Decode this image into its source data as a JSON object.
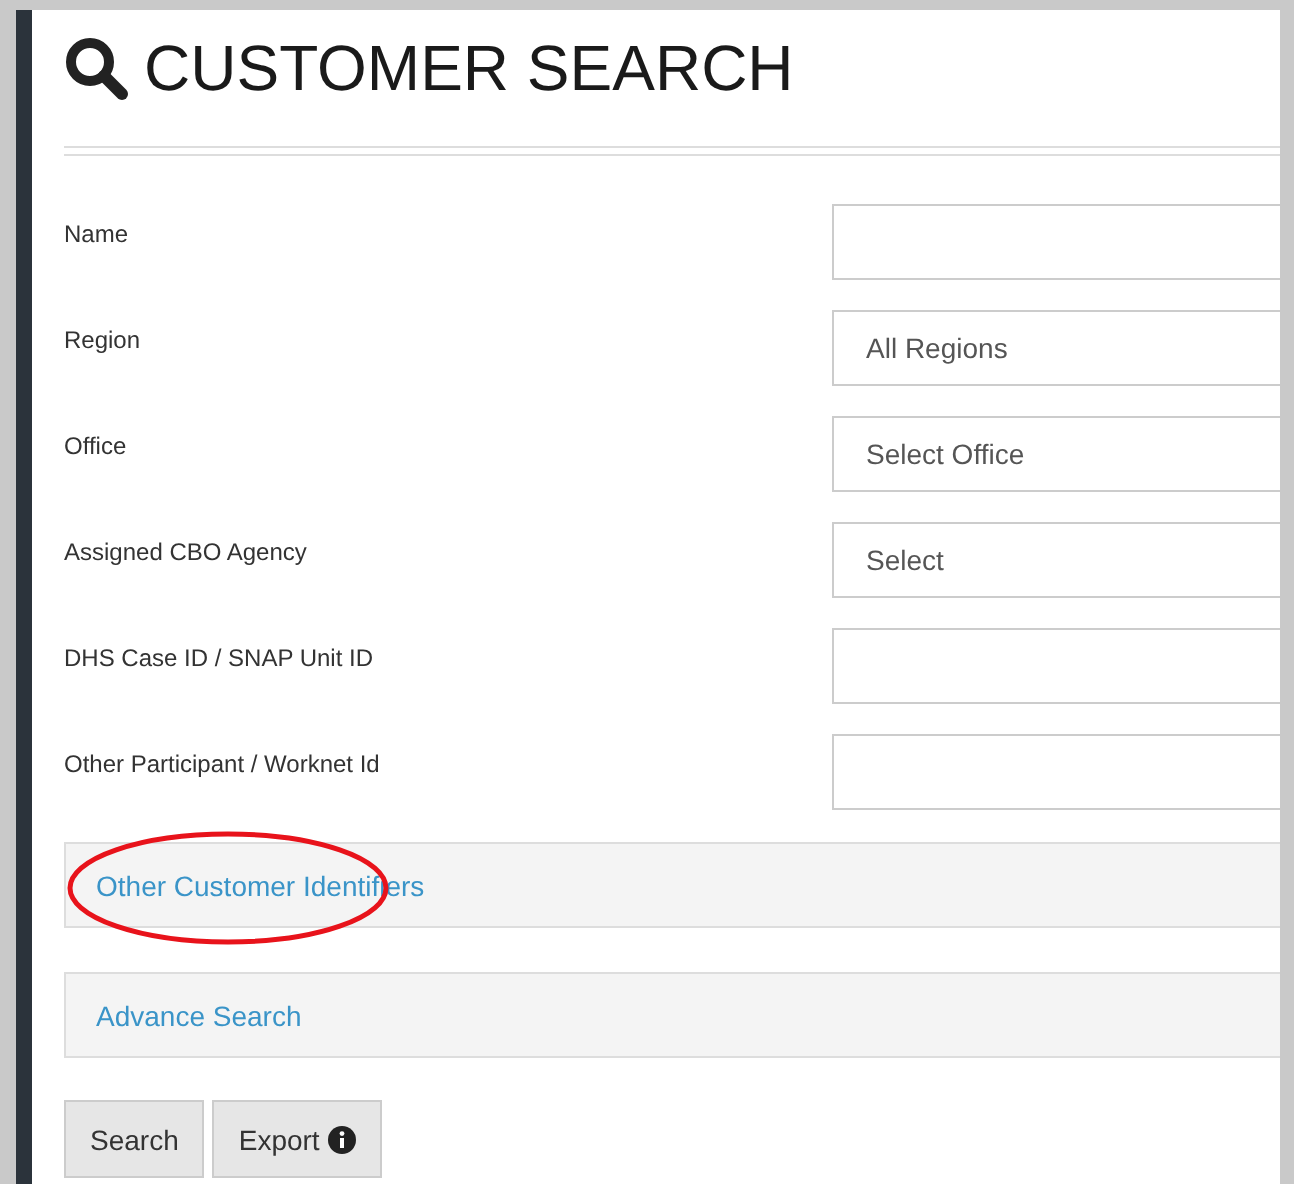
{
  "header": {
    "title": "CUSTOMER SEARCH"
  },
  "fields": [
    {
      "label": "Name"
    },
    {
      "label": "Region",
      "value": "All Regions"
    },
    {
      "label": "Office",
      "value": "Select Office"
    },
    {
      "label": "Assigned CBO Agency",
      "value": "Select"
    },
    {
      "label": "DHS Case ID / SNAP Unit ID"
    },
    {
      "label": "Other Participant / Worknet Id"
    }
  ],
  "panels": [
    {
      "label": "Other Customer Identifiers",
      "highlighted": true
    },
    {
      "label": "Advance Search",
      "highlighted": false
    }
  ],
  "buttons": [
    {
      "label": "Search",
      "info": false
    },
    {
      "label": "Export",
      "info": true
    }
  ]
}
